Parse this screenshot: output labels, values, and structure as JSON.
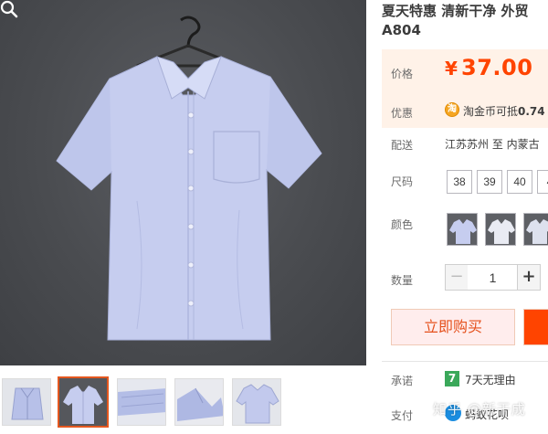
{
  "product": {
    "title_line1": "夏天特惠 清新干净 外贸",
    "title_line2": "A804"
  },
  "price": {
    "label": "价格",
    "symbol": "¥",
    "value": "37.00",
    "color": "#ff4400"
  },
  "promo": {
    "label": "优惠",
    "icon": "taojinbi-coin-icon",
    "text_prefix": "淘金币可抵",
    "text_bold": "0.74"
  },
  "shipping": {
    "label": "配送",
    "text": "江苏苏州 至  内蒙古"
  },
  "size": {
    "label": "尺码",
    "options": [
      "38",
      "39",
      "40",
      "4"
    ]
  },
  "color": {
    "label": "颜色",
    "swatch_count": 3
  },
  "quantity": {
    "label": "数量",
    "minus": "−",
    "value": "1",
    "plus": "+"
  },
  "actions": {
    "buy_now": "立即购买",
    "accent": "#ff4400"
  },
  "promise": {
    "label": "承诺",
    "icon_glyph": "7",
    "text": "7天无理由"
  },
  "payment": {
    "label": "支付",
    "icon": "ant-credit-icon",
    "text": "蚂蚁花呗"
  },
  "watermark": "知乎 @新干成"
}
